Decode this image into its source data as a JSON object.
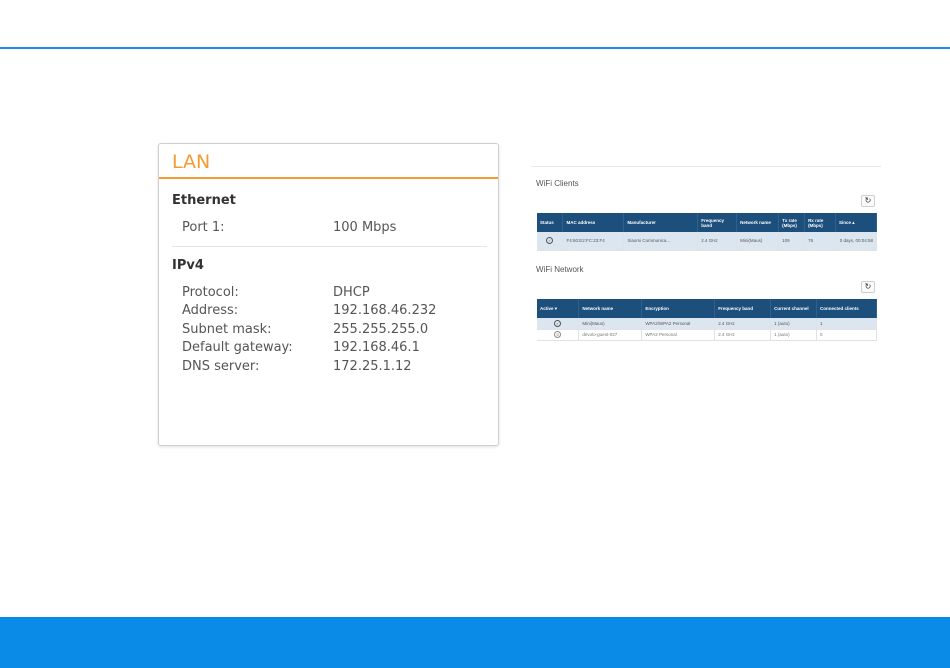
{
  "lan": {
    "title": "LAN",
    "ethernet": {
      "heading": "Ethernet",
      "port1_label": "Port 1:",
      "port1_value": "100 Mbps"
    },
    "ipv4": {
      "heading": "IPv4",
      "rows": [
        {
          "label": "Protocol:",
          "value": "DHCP"
        },
        {
          "label": "Address:",
          "value": "192.168.46.232"
        },
        {
          "label": "Subnet mask:",
          "value": "255.255.255.0"
        },
        {
          "label": "Default gateway:",
          "value": "192.168.46.1"
        },
        {
          "label": "DNS server:",
          "value": "172.25.1.12"
        }
      ]
    }
  },
  "wifi_clients": {
    "title": "WiFi Clients",
    "refresh_icon": "refresh-icon",
    "columns": [
      "Status",
      "MAC address",
      "Manufacturer",
      "Frequency band",
      "Network name",
      "Tx rate (Mbps)",
      "Rx rate (Mbps)",
      "Since ▴"
    ],
    "rows": [
      {
        "status_icon": "check-circle-icon",
        "mac": "F4:60:E2:FC:23:F4",
        "manufacturer": "Xiaomi Communica...",
        "band": "2.4 GHz",
        "network": "Mini(Maus)",
        "tx": "109",
        "rx": "76",
        "since": "0 days, 00:04:58"
      }
    ]
  },
  "wifi_network": {
    "title": "WiFi Network",
    "refresh_icon": "refresh-icon",
    "columns": [
      "Active ▾",
      "Network name",
      "Encryption",
      "Frequency band",
      "Current channel",
      "Connected clients"
    ],
    "rows": [
      {
        "active_icon": "check-circle-icon",
        "name": "Mini(Maus)",
        "encryption": "WPA2/WPA2 Personal",
        "band": "2.4 GHz",
        "channel": "1 (auto)",
        "clients": "1"
      },
      {
        "active_icon": "disabled-circle-icon",
        "name": "devolo-guest-027",
        "encryption": "WPA2 Personal",
        "band": "2.4 GHz",
        "channel": "1 (auto)",
        "clients": "0"
      }
    ]
  },
  "colors": {
    "accent_blue": "#0a8be8",
    "lan_orange": "#f39c35",
    "table_header": "#1d4f7c"
  }
}
